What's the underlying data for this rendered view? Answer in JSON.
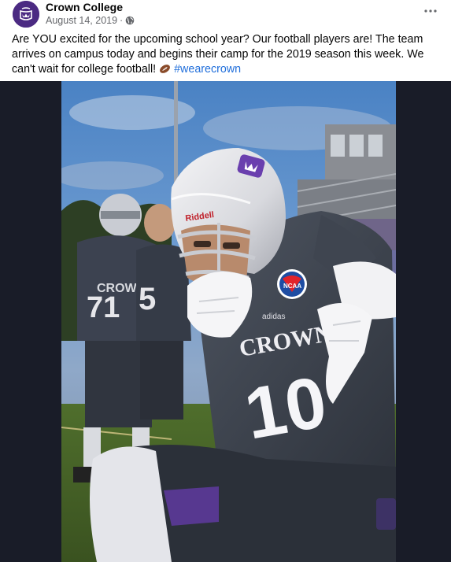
{
  "post": {
    "author": "Crown College",
    "date": "August 14, 2019",
    "separator": "·",
    "audience_icon": "globe-icon",
    "more_icon": "more-options-icon",
    "caption": "Are YOU excited for the upcoming school year? Our football players are! The team arrives on campus today and begins their camp for the 2019 season this week. We can't wait for college football!",
    "caption_emoji": "football-emoji",
    "hashtag": "#wearecrown"
  },
  "photo": {
    "helmet_brand": "Riddell",
    "jersey_text": "CROWN",
    "jersey_number": "10",
    "teammate_number_left": "71",
    "teammate_number_right": "5",
    "patch_text": "NCAA",
    "apparel_brand": "adidas"
  },
  "colors": {
    "brand_purple": "#4b2a82",
    "hashtag_blue": "#216fdb",
    "meta_gray": "#65676b",
    "photo_frame": "#191c28"
  }
}
